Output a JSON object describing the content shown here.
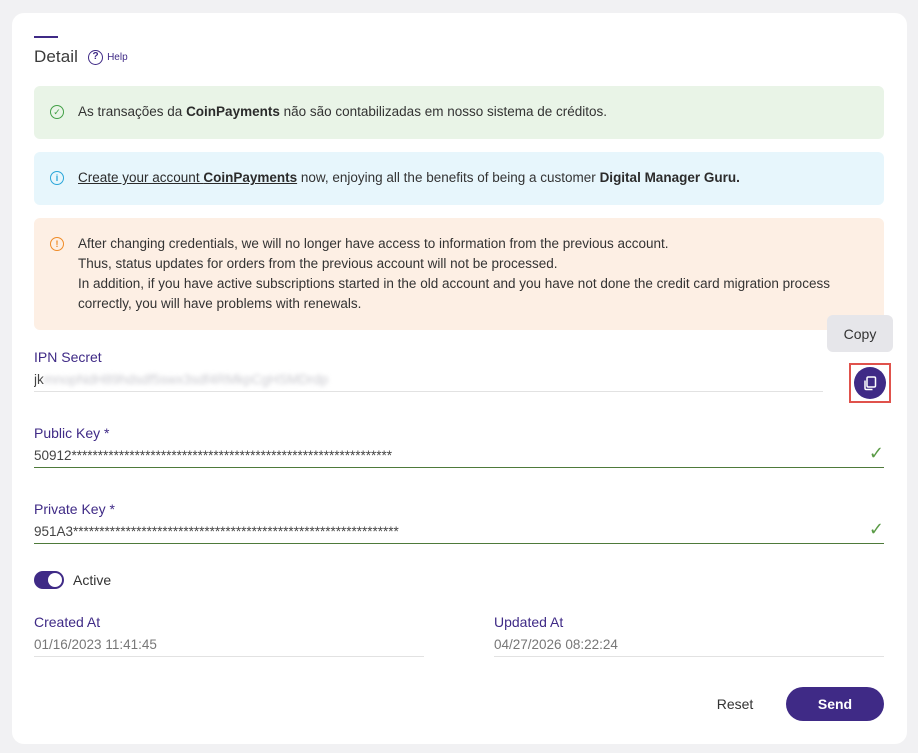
{
  "header": {
    "title": "Detail",
    "help_icon": "question-circle-icon",
    "help_label": "Help"
  },
  "alerts": {
    "success": {
      "icon": "check-circle-icon",
      "text_before": "As transações da ",
      "bold": "CoinPayments",
      "text_after": " não são contabilizadas em nosso sistema de créditos."
    },
    "info": {
      "icon": "info-circle-icon",
      "link_text": "Create your account ",
      "link_bold": "CoinPayments",
      "text_middle": " now, enjoying all the benefits of being a customer ",
      "bold_end": "Digital Manager Guru."
    },
    "warning": {
      "icon": "exclamation-circle-icon",
      "lines": [
        "After changing credentials, we will no longer have access to information from the previous account.",
        "Thus, status updates for orders from the previous account will not be processed.",
        "In addition, if you have active subscriptions started in the old account and you have not done the credit card migration process correctly, you will have problems with renewals."
      ]
    }
  },
  "fields": {
    "ipn_secret": {
      "label": "IPN Secret",
      "visible_prefix": "jk",
      "blurred_value": "mnopNdH89hdsdf5swx3sdf4RMkpCgHSMDrdp"
    },
    "public_key": {
      "label": "Public Key *",
      "value": "50912*************************************************************"
    },
    "private_key": {
      "label": "Private Key *",
      "value": "951A3**************************************************************"
    },
    "created_at": {
      "label": "Created At",
      "value": "01/16/2023 11:41:45"
    },
    "updated_at": {
      "label": "Updated At",
      "value": "04/27/2026 08:22:24"
    }
  },
  "copy": {
    "tooltip": "Copy",
    "icon": "copy-icon"
  },
  "toggle": {
    "label": "Active",
    "checked": true
  },
  "actions": {
    "reset_label": "Reset",
    "send_label": "Send"
  },
  "colors": {
    "brand": "#3f2a86",
    "success_bg": "#e9f4e7",
    "info_bg": "#e7f6fc",
    "warning_bg": "#fdefe4",
    "valid_underline": "#4e7a3a",
    "highlight_border": "#e0524c"
  }
}
